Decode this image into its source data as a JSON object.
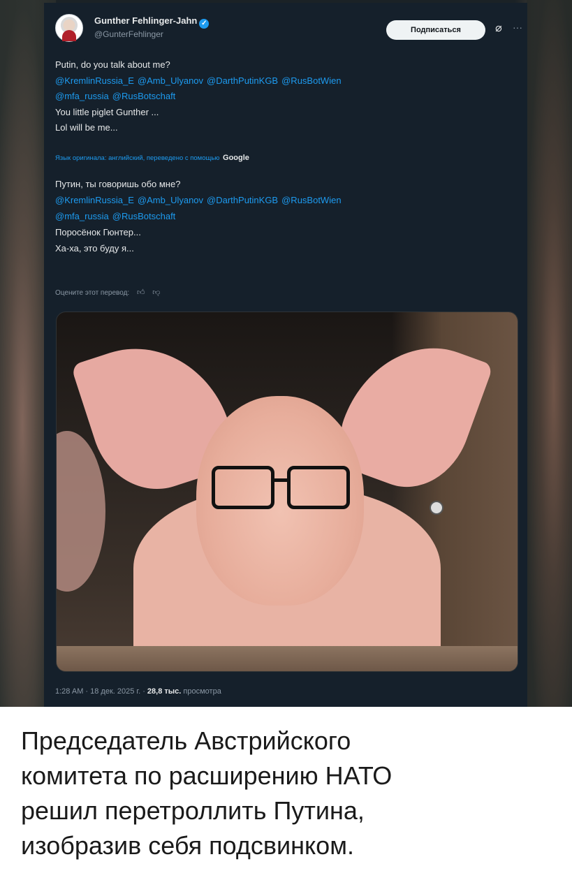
{
  "tweet": {
    "author_name": "Gunther Fehlinger-Jahn",
    "author_handle": "@GunterFehlinger",
    "subscribe_label": "Подписаться",
    "more_icon": "more-icon",
    "original_lines": [
      "Putin, do you talk about me?",
      "You little piglet Gunther ...",
      "Lol will be me..."
    ],
    "mentions_line1": [
      "@KremlinRussia_E",
      "@Amb_Ulyanov",
      "@DarthPutinKGB",
      "@RusBotWien"
    ],
    "mentions_line2": [
      "@mfa_russia",
      "@RusBotschaft"
    ],
    "translation_note": "Язык оригинала: английский, переведено с помощью",
    "translation_brand": "Google",
    "translated_lines": [
      "Путин, ты говоришь обо мне?",
      "Поросёнок Гюнтер...",
      "Ха-ха, это буду я..."
    ],
    "rate_label": "Оцените этот перевод:",
    "timestamp": "1:28 AM · 18 дек. 2025 г. ·",
    "views_count": "28,8 тыс.",
    "views_label": "просмотра",
    "accent_color": "#1d9bf0",
    "background_color": "#15202b"
  },
  "caption": {
    "lines": [
      "Председатель Австрийского",
      "комитета по расширению НАТО",
      "решил перетроллить Путина,",
      "изобразив себя подсвинком."
    ]
  }
}
